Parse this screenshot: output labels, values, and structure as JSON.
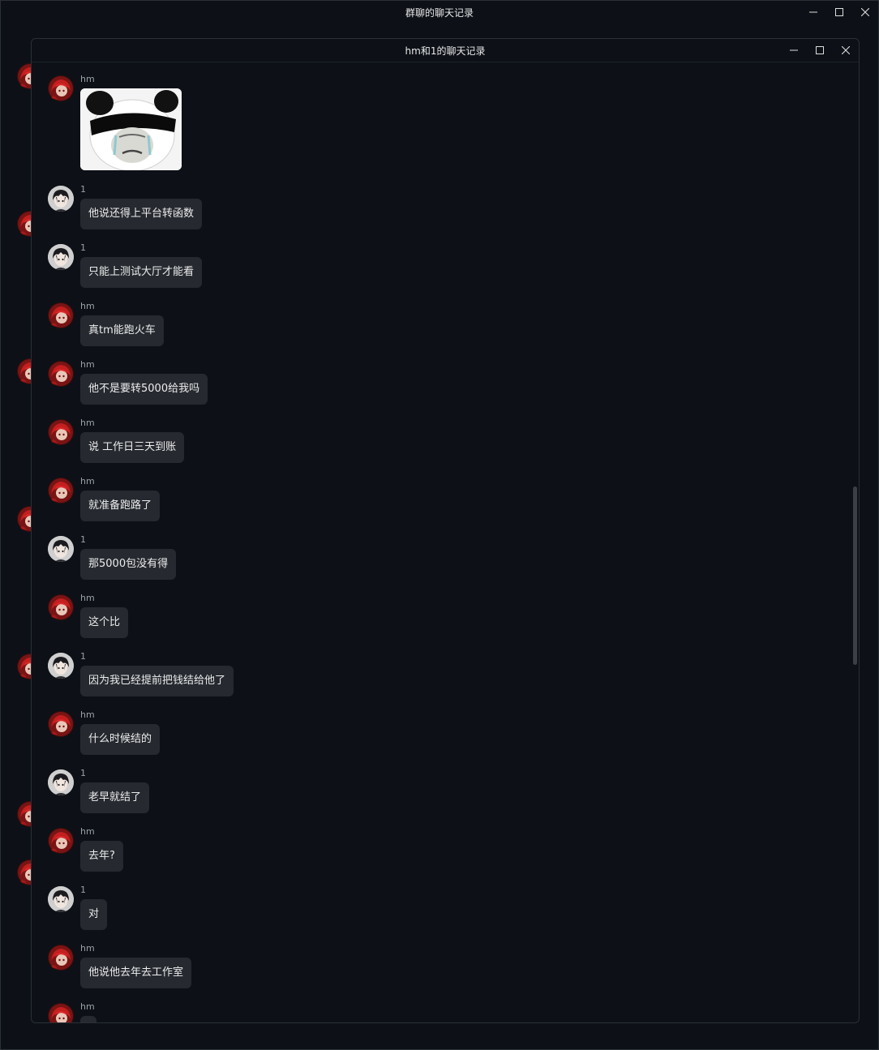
{
  "outer_window": {
    "title": "群聊的聊天记录"
  },
  "inner_window": {
    "title": "hm和1的聊天记录"
  },
  "window_controls": {
    "minimize_icon": "minimize-icon",
    "maximize_icon": "maximize-icon",
    "close_icon": "close-icon"
  },
  "avatars": {
    "hm": "red-haired-anime-avatar",
    "1": "dark-haired-anime-avatar"
  },
  "messages": [
    {
      "sender": "hm",
      "type": "sticker",
      "sticker": "panda-meme-sticker"
    },
    {
      "sender": "1",
      "type": "text",
      "text": "他说还得上平台转函数"
    },
    {
      "sender": "1",
      "type": "text",
      "text": "只能上测试大厅才能看"
    },
    {
      "sender": "hm",
      "type": "text",
      "text": "真tm能跑火车"
    },
    {
      "sender": "hm",
      "type": "text",
      "text": "他不是要转5000给我吗"
    },
    {
      "sender": "hm",
      "type": "text",
      "text": "说 工作日三天到账"
    },
    {
      "sender": "hm",
      "type": "text",
      "text": "就准备跑路了"
    },
    {
      "sender": "1",
      "type": "text",
      "text": "那5000包没有得"
    },
    {
      "sender": "hm",
      "type": "text",
      "text": "这个比"
    },
    {
      "sender": "1",
      "type": "text",
      "text": "因为我已经提前把钱结给他了"
    },
    {
      "sender": "hm",
      "type": "text",
      "text": "什么时候结的"
    },
    {
      "sender": "1",
      "type": "text",
      "text": "老早就结了"
    },
    {
      "sender": "hm",
      "type": "text",
      "text": "去年?"
    },
    {
      "sender": "1",
      "type": "text",
      "text": "对"
    },
    {
      "sender": "hm",
      "type": "text",
      "text": "他说他去年去工作室"
    },
    {
      "sender": "hm",
      "type": "text",
      "text": ""
    }
  ]
}
